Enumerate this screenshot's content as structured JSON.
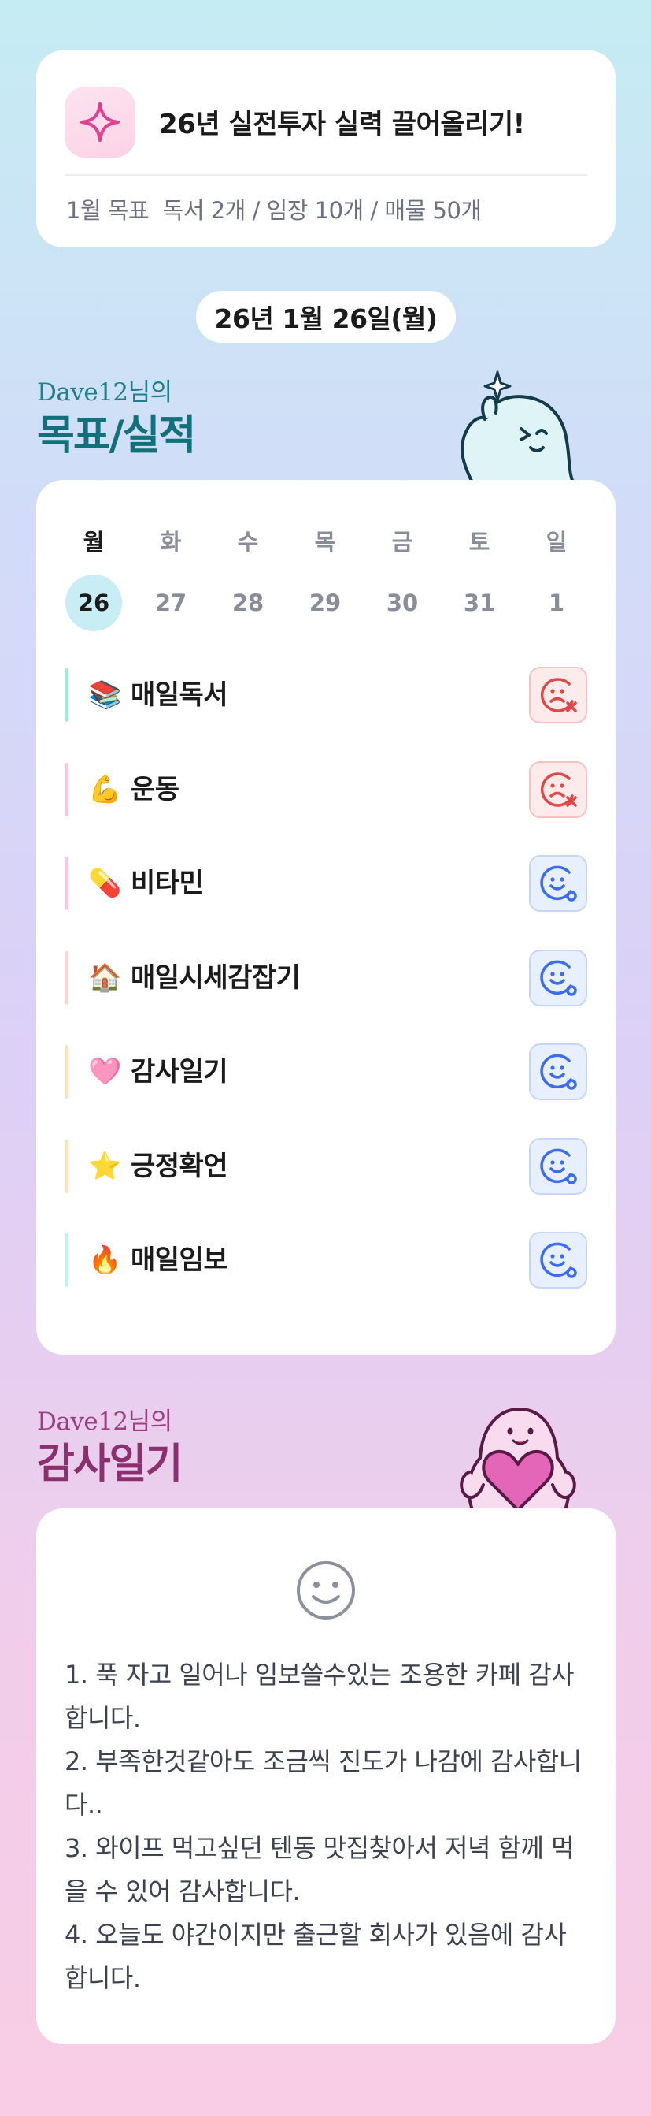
{
  "goal": {
    "title": "26년 실전투자 실력 끌어올리기!",
    "subtitle": "1월 목표  독서 2개 / 임장 10개 / 매물 50개",
    "icon": "sparkle-icon"
  },
  "date": "26년 1월 26일(월)",
  "checklist_section": {
    "owner": "Dave12님의",
    "title": "목표/실적"
  },
  "week": {
    "days": [
      "월",
      "화",
      "수",
      "목",
      "금",
      "토",
      "일"
    ],
    "dates": [
      "26",
      "27",
      "28",
      "29",
      "30",
      "31",
      "1"
    ],
    "selected_index": 0
  },
  "habits": [
    {
      "emoji": "📚",
      "label": "매일독서",
      "status": "fail",
      "bar_color": "#a6e8d6"
    },
    {
      "emoji": "💪",
      "label": "운동",
      "status": "fail",
      "bar_color": "#f7c6e0"
    },
    {
      "emoji": "💊",
      "label": "비타민",
      "status": "done",
      "bar_color": "#f7c6e0"
    },
    {
      "emoji": "🏠",
      "label": "매일시세감잡기",
      "status": "done",
      "bar_color": "#fbd6d2"
    },
    {
      "emoji": "🩷",
      "label": "감사일기",
      "status": "done",
      "bar_color": "#fde0c4"
    },
    {
      "emoji": "⭐",
      "label": "긍정확언",
      "status": "done",
      "bar_color": "#fde0c4"
    },
    {
      "emoji": "🔥",
      "label": "매일임보",
      "status": "done",
      "bar_color": "#c6eef3"
    }
  ],
  "journal_section": {
    "owner": "Dave12님의",
    "title": "감사일기"
  },
  "journal": {
    "icon": "smile-icon",
    "entries": [
      "1. 푹 자고 일어나 임보쓸수있는 조용한 카페 감사합니다.",
      "2. 부족한것같아도 조금씩 진도가 나감에 감사합니다..",
      "3. 와이프 먹고싶던 텐동 맛집찾아서 저녁 함께 먹을 수 있어 감사합니다.",
      "4. 오늘도 야간이지만 출근할 회사가 있음에 감사합니다."
    ]
  },
  "colors": {
    "accent_teal": "#12707b",
    "accent_magenta": "#8c2f6e",
    "fail_red": "#e04848",
    "done_blue": "#3a6df0"
  }
}
